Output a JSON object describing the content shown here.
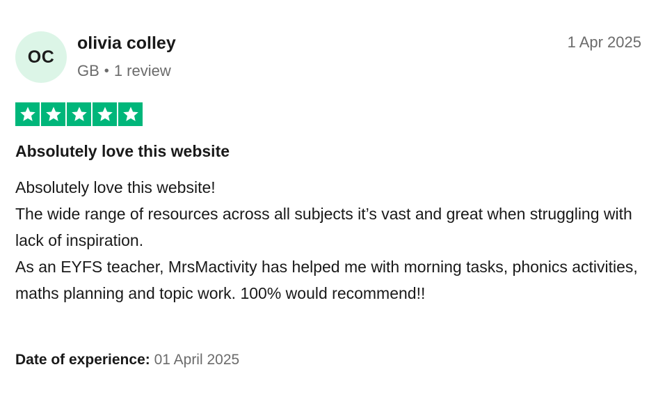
{
  "reviewer": {
    "initials": "OC",
    "name": "olivia colley",
    "country": "GB",
    "separator": "•",
    "review_count": "1 review"
  },
  "review": {
    "date": "1 Apr 2025",
    "rating": 5,
    "rating_max": 5,
    "star_color": "#00b67a",
    "title": "Absolutely love this website",
    "body_lines": [
      "Absolutely love this website!",
      "The wide range of resources across all subjects it’s vast and great when struggling with lack of inspiration.",
      "As an EYFS teacher, MrsMactivity has helped me with morning tasks, phonics activities, maths planning and topic work. 100% would recommend!!"
    ],
    "experience_label": "Date of experience:",
    "experience_date": "01 April 2025"
  },
  "colors": {
    "avatar_bg": "#dcf5e7",
    "muted_text": "#6b6b6b",
    "text": "#191919"
  }
}
